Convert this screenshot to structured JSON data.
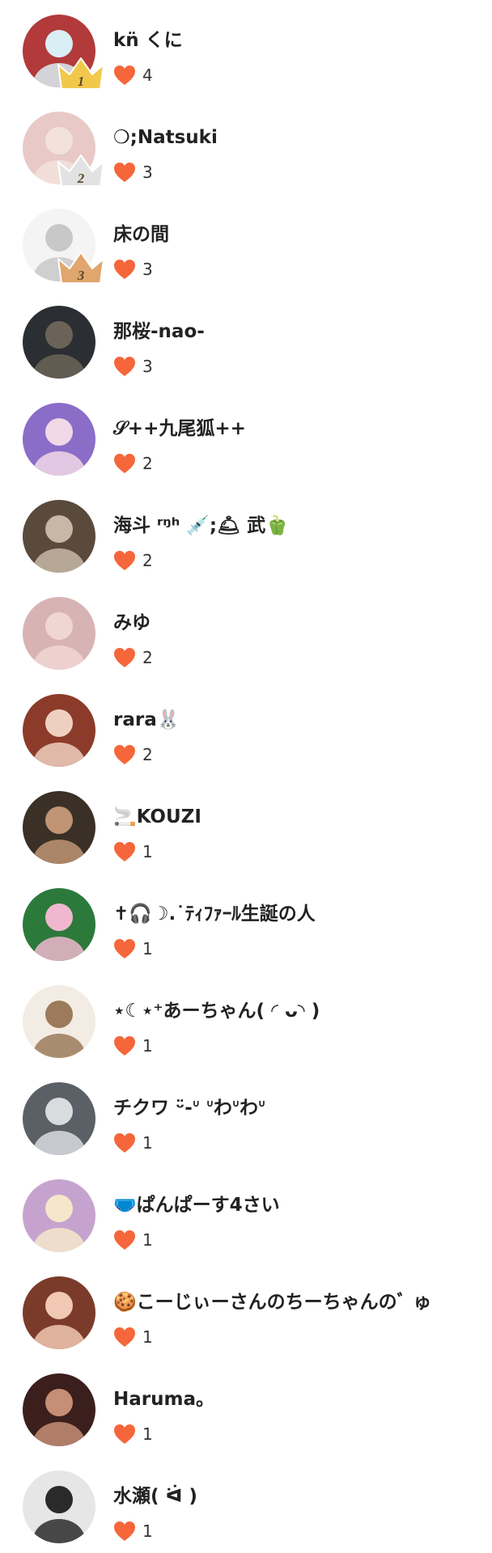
{
  "colors": {
    "heart": "#f5663a",
    "gold_crown": "#f2c84b",
    "silver_crown": "#e2e2e2",
    "bronze_crown": "#e0a66d",
    "text": "#222222"
  },
  "users": [
    {
      "name": "kn̈ くに",
      "likes": "4",
      "rank": "1",
      "avatar_bg": "#b23a3a",
      "avatar_fg": "#d9eef5"
    },
    {
      "name": "❍;Natsuki",
      "likes": "3",
      "rank": "2",
      "avatar_bg": "#e8c9c6",
      "avatar_fg": "#f3e2dc"
    },
    {
      "name": "床の間",
      "likes": "3",
      "rank": "3",
      "avatar_bg": "#f4f4f4",
      "avatar_fg": "#c8c8c8"
    },
    {
      "name": "那桜-nao-",
      "likes": "3",
      "rank": "",
      "avatar_bg": "#2b2f33",
      "avatar_fg": "#6b6357"
    },
    {
      "name": "𝒮++九尾狐++",
      "likes": "2",
      "rank": "",
      "avatar_bg": "#8a6dc7",
      "avatar_fg": "#f1d8e6"
    },
    {
      "name": "海斗 ʳᵑʰ 💉;🛎 武🫑",
      "likes": "2",
      "rank": "",
      "avatar_bg": "#5a4a3c",
      "avatar_fg": "#c7b7a6"
    },
    {
      "name": "みゆ",
      "likes": "2",
      "rank": "",
      "avatar_bg": "#d8b3b3",
      "avatar_fg": "#f0d6d2"
    },
    {
      "name": "rara🐰",
      "likes": "2",
      "rank": "",
      "avatar_bg": "#8c3b2a",
      "avatar_fg": "#efd0c0"
    },
    {
      "name": "🚬KOUZI",
      "likes": "1",
      "rank": "",
      "avatar_bg": "#3a3026",
      "avatar_fg": "#c09474"
    },
    {
      "name": "✝🎧☽.˙ﾃｨﾌｧｰﾙ生誕の人",
      "likes": "1",
      "rank": "",
      "avatar_bg": "#2c7a3b",
      "avatar_fg": "#f0b8cf"
    },
    {
      "name": "⋆☾⋆⁺あーちゃん( ◜ ᴗ◝ )",
      "likes": "1",
      "rank": "",
      "avatar_bg": "#f3ece4",
      "avatar_fg": "#9b7b5b"
    },
    {
      "name": "チクワ ᵕ̈-ᐡ ᐡわᐡわᐡ",
      "likes": "1",
      "rank": "",
      "avatar_bg": "#5b6066",
      "avatar_fg": "#d9dcdf"
    },
    {
      "name": "🩲ぱんぱーす4さい",
      "likes": "1",
      "rank": "",
      "avatar_bg": "#c6a3cf",
      "avatar_fg": "#f4e7c9"
    },
    {
      "name": "🍪こーじぃーさんのちーちゃんのﾞ ゅ",
      "likes": "1",
      "rank": "",
      "avatar_bg": "#7b3b2a",
      "avatar_fg": "#f1c8b3"
    },
    {
      "name": "Haruma。",
      "likes": "1",
      "rank": "",
      "avatar_bg": "#3b1f1d",
      "avatar_fg": "#c58e76"
    },
    {
      "name": "水瀬( ᐛ )",
      "likes": "1",
      "rank": "",
      "avatar_bg": "#e6e6e6",
      "avatar_fg": "#2a2a2a"
    }
  ]
}
